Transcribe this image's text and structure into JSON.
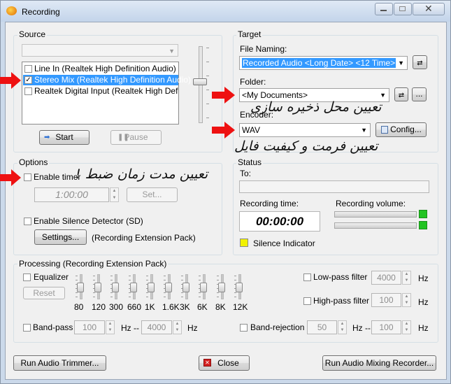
{
  "window": {
    "title": "Recording"
  },
  "source": {
    "group_label": "Source",
    "devices": [
      {
        "label": "Line In (Realtek High Definition Audio)",
        "checked": false
      },
      {
        "label": "Stereo Mix (Realtek High Definition Audio)",
        "checked": true
      },
      {
        "label": "Realtek Digital Input (Realtek High Definitio",
        "checked": false
      }
    ],
    "start_label": "Start",
    "pause_label": "Pause"
  },
  "target": {
    "group_label": "Target",
    "file_naming_label": "File Naming:",
    "file_naming_value": "Recorded Audio <Long Date> <12 Time>",
    "folder_label": "Folder:",
    "folder_value": "<My Documents>",
    "browse_label": "...",
    "encoder_label": "Encoder:",
    "encoder_value": "WAV",
    "config_label": "Config..."
  },
  "options": {
    "group_label": "Options",
    "enable_timer_label": "Enable timer",
    "timer_value": "1:00:00",
    "set_label": "Set...",
    "silence_detector_label": "Enable Silence Detector (SD)",
    "settings_label": "Settings...",
    "extension_note": "(Recording Extension Pack)"
  },
  "status": {
    "group_label": "Status",
    "to_label": "To:",
    "recording_time_label": "Recording time:",
    "recording_time_value": "00:00:00",
    "recording_volume_label": "Recording volume:",
    "silence_indicator_label": "Silence Indicator",
    "silence_indicator_color": "#f2f200",
    "volume_indicator_color": "#22c322"
  },
  "processing": {
    "group_label": "Processing (Recording Extension Pack)",
    "equalizer_label": "Equalizer",
    "reset_label": "Reset",
    "eq_bands": [
      "80",
      "120",
      "300",
      "660",
      "1K",
      "1.6K",
      "3K",
      "6K",
      "8K",
      "12K"
    ],
    "lowpass_label": "Low-pass filter",
    "lowpass_value": "4000",
    "highpass_label": "High-pass filter",
    "highpass_value": "100",
    "hz_label": "Hz",
    "bandpass_label": "Band-pass",
    "bandpass_low": "100",
    "bandpass_high": "4000",
    "bandrejection_label": "Band-rejection",
    "bandrejection_low": "50",
    "bandrejection_high": "100",
    "hz_dash_label": "Hz --"
  },
  "footer": {
    "run_trimmer_label": "Run Audio Trimmer...",
    "close_label": "Close",
    "run_mixing_label": "Run Audio Mixing Recorder..."
  },
  "annotations": {
    "folder_note": "تعیین محل ذخیره سازی",
    "encoder_note": "تعیین فرمت و کیفیت فایل",
    "timer_note": "تعیین مدت زمان ضبط !"
  }
}
